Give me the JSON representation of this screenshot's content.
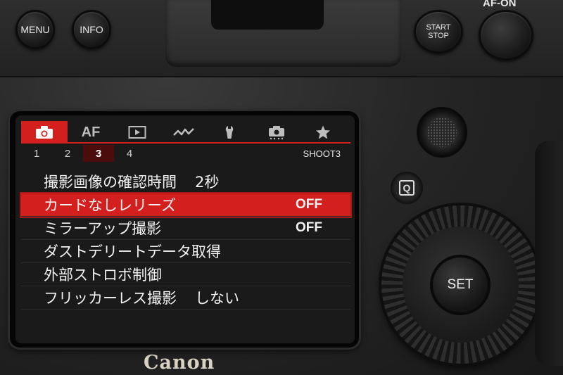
{
  "camera": {
    "buttons": {
      "menu": "MENU",
      "info": "INFO",
      "start_stop_line1": "START",
      "start_stop_line2": "STOP",
      "af_on": "AF-ON",
      "q": "Q",
      "set": "SET"
    },
    "brand": "Canon"
  },
  "screen": {
    "tabs": [
      {
        "icon": "camera-icon",
        "active": true
      },
      {
        "label": "AF",
        "icon": "af-icon",
        "active": false
      },
      {
        "icon": "playback-icon",
        "active": false
      },
      {
        "icon": "wireless-icon",
        "active": false
      },
      {
        "icon": "wrench-icon",
        "active": false
      },
      {
        "icon": "custom-function-icon",
        "active": false
      },
      {
        "icon": "star-icon",
        "active": false
      }
    ],
    "pages": [
      "1",
      "2",
      "3",
      "4"
    ],
    "active_page": "3",
    "page_label": "SHOOT3",
    "accent_color": "#d41f1f",
    "items": [
      {
        "label": "撮影画像の確認時間",
        "inline_value": "2秒",
        "value": ""
      },
      {
        "label": "カードなしレリーズ",
        "inline_value": "",
        "value": "OFF",
        "selected": true
      },
      {
        "label": "ミラーアップ撮影",
        "inline_value": "",
        "value": "OFF"
      },
      {
        "label": "ダストデリートデータ取得",
        "inline_value": "",
        "value": ""
      },
      {
        "label": "外部ストロボ制御",
        "inline_value": "",
        "value": ""
      },
      {
        "label": "フリッカーレス撮影",
        "inline_value": "しない",
        "value": ""
      }
    ]
  }
}
